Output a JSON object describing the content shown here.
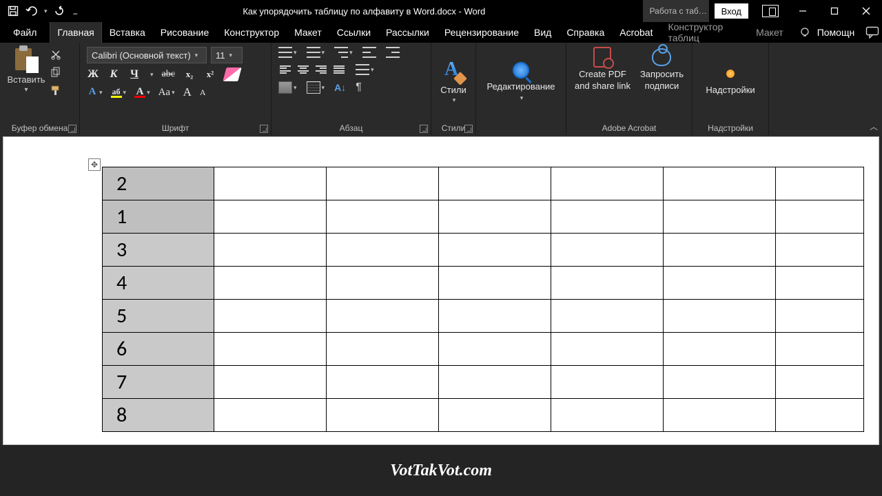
{
  "title": "Как упорядочить таблицу по алфавиту в Word.docx  -  Word",
  "table_tools_tab": "Работа с таб…",
  "login_label": "Вход",
  "tabs": {
    "file": "Файл",
    "home": "Главная",
    "insert": "Вставка",
    "draw": "Рисование",
    "design": "Конструктор",
    "layout": "Макет",
    "references": "Ссылки",
    "mailings": "Рассылки",
    "review": "Рецензирование",
    "view": "Вид",
    "help": "Справка",
    "acrobat": "Acrobat",
    "ctx_design": "Конструктор таблиц",
    "ctx_layout": "Макет",
    "tell_me": "Помощн"
  },
  "groups": {
    "clipboard": "Буфер обмена",
    "font": "Шрифт",
    "paragraph": "Абзац",
    "styles": "Стили",
    "acrobat": "Adobe Acrobat",
    "addins": "Надстройки"
  },
  "ribbon": {
    "paste": "Вставить",
    "font_name": "Calibri (Основной текст)",
    "font_size": "11",
    "bold": "Ж",
    "italic": "К",
    "underline": "Ч",
    "strike": "abc",
    "sub": "x₂",
    "sup": "x²",
    "textfx": "A",
    "highlight": "aб",
    "fontcolor": "A",
    "case": "Aa",
    "grow": "A",
    "shrink": "A",
    "sort": "А↓",
    "pilcrow": "¶",
    "styles": "Стили",
    "editing": "Редактирование",
    "create_pdf_l1": "Create PDF",
    "create_pdf_l2": "and share link",
    "req_sig_l1": "Запросить",
    "req_sig_l2": "подписи",
    "addins": "Надстройки"
  },
  "table_rows": [
    "2",
    "1",
    "3",
    "4",
    "5",
    "6",
    "7",
    "8"
  ],
  "watermark": "VotTakVot.com"
}
